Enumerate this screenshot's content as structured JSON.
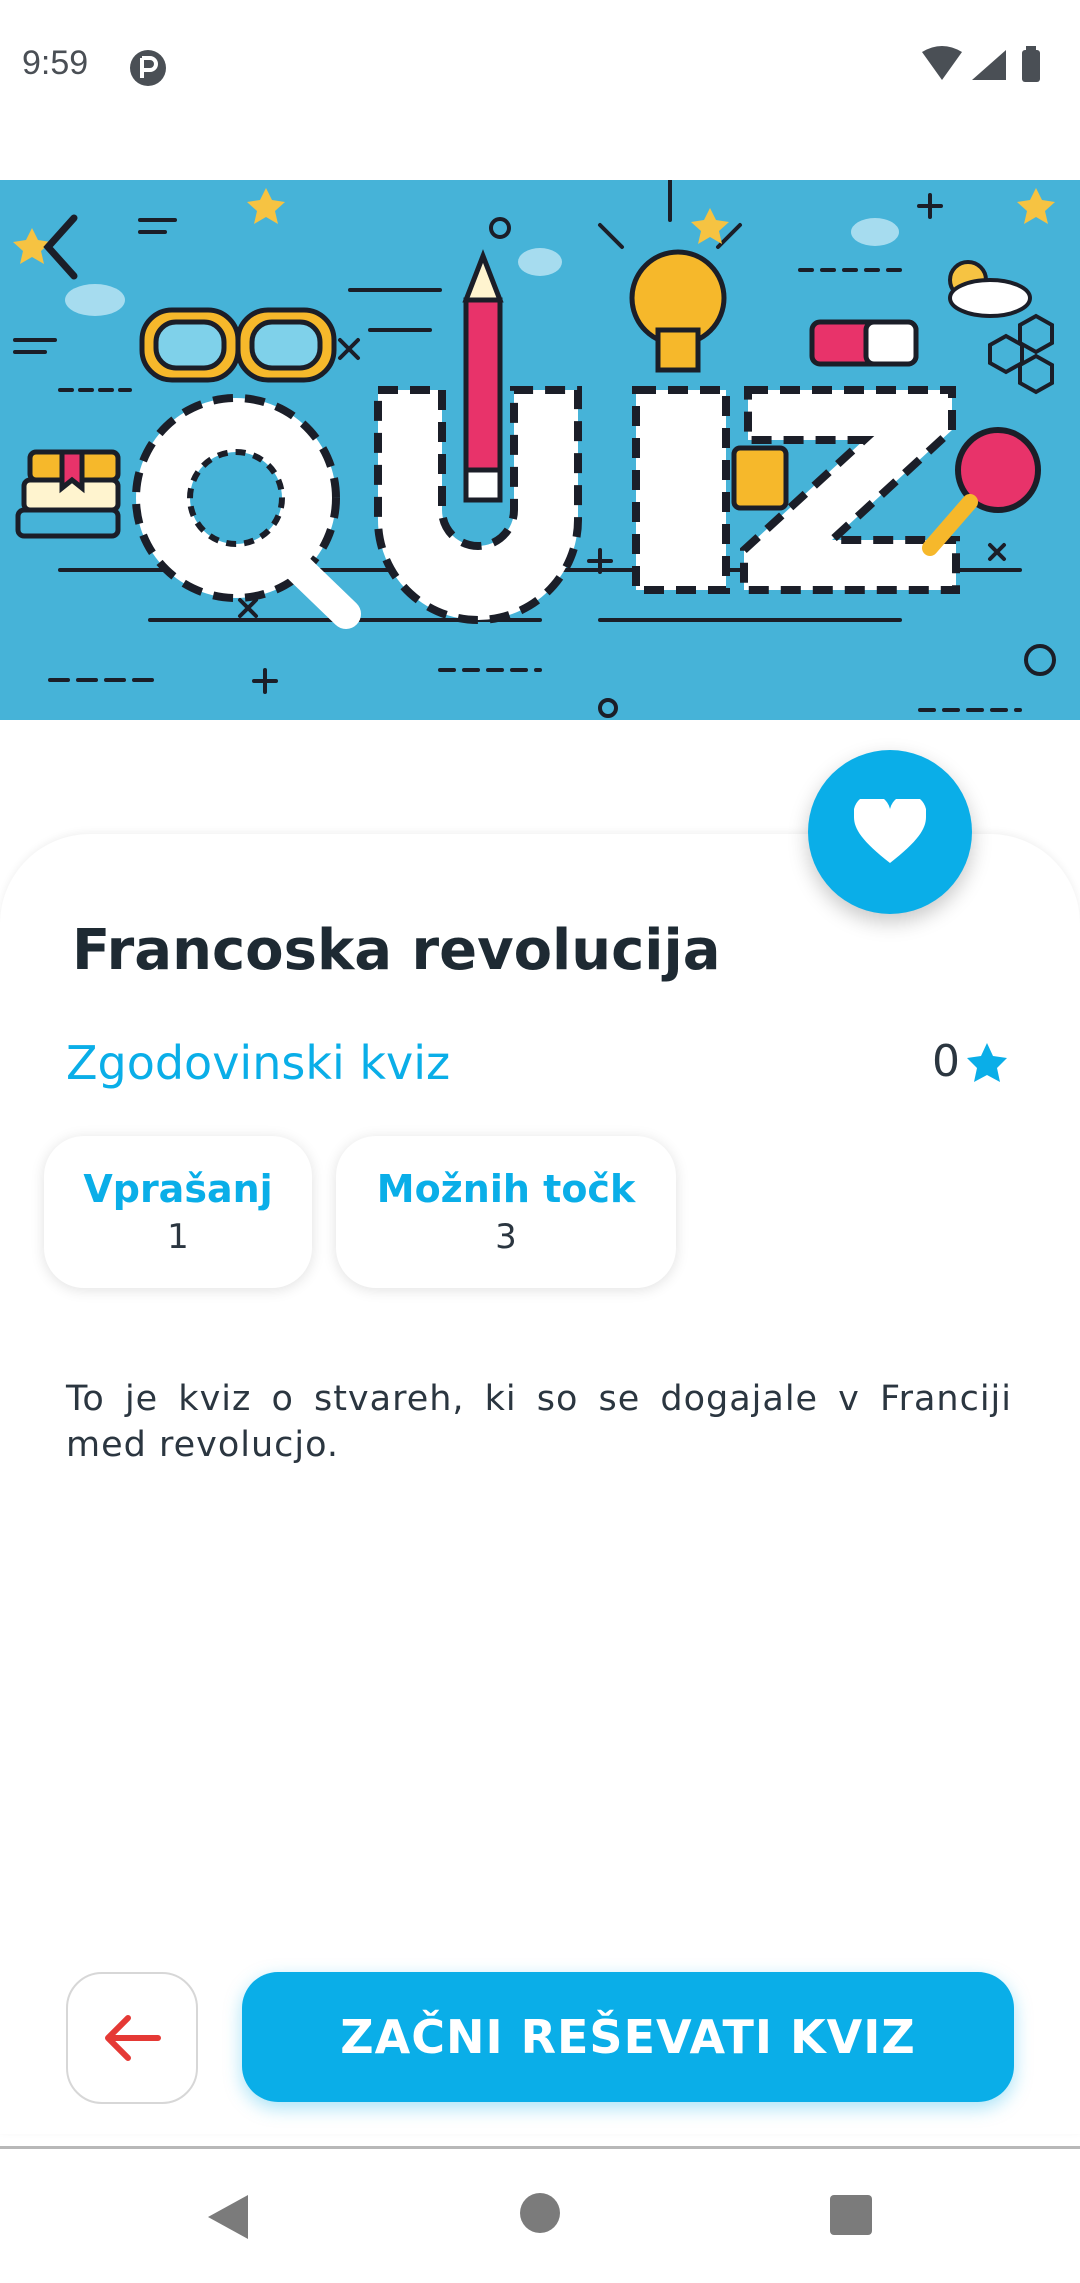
{
  "status_bar": {
    "time": "9:59"
  },
  "quiz": {
    "title": "Francoska revolucija",
    "category": "Zgodovinski kviz",
    "rating": "0",
    "stats": [
      {
        "label": "Vprašanj",
        "value": "1"
      },
      {
        "label": "Možnih točk",
        "value": "3"
      }
    ],
    "description": "To je kviz o stvareh, ki so se dogajale v Franciji med revolucjo."
  },
  "actions": {
    "start_label": "ZAČNI REŠEVATI KVIZ"
  },
  "colors": {
    "accent": "#0aaee8",
    "hero_background": "#46b3d8",
    "back_arrow": "#e53935"
  },
  "icons": {
    "status": [
      "app-notification-icon",
      "wifi-icon",
      "signal-icon",
      "battery-icon"
    ],
    "header": "chevron-left-icon",
    "favorite": "heart-icon",
    "rating": "star-icon",
    "back": "arrow-left-icon",
    "nav": [
      "nav-back-icon",
      "nav-home-icon",
      "nav-recents-icon"
    ]
  }
}
